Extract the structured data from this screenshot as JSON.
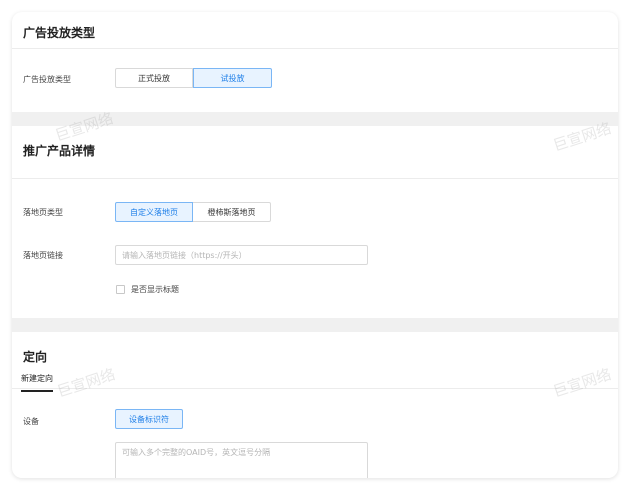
{
  "ad_type_section": {
    "title": "广告投放类型",
    "field_label": "广告投放类型",
    "options": [
      "正式投放",
      "试投放"
    ],
    "selected": "试投放"
  },
  "promo_section": {
    "title": "推广产品详情",
    "landing_type_label": "落地页类型",
    "landing_options": [
      "自定义落地页",
      "橙柿斯落地页"
    ],
    "landing_selected": "自定义落地页",
    "url_label": "落地页链接",
    "url_placeholder": "请输入落地页链接（https://开头）",
    "show_title_label": "是否显示标题",
    "show_title_checked": false
  },
  "targeting_section": {
    "title": "定向",
    "tab_label": "新建定向",
    "device_label": "设备",
    "device_button": "设备标识符",
    "oaid_placeholder": "可输入多个完整的OAID号，英文逗号分隔"
  },
  "watermark": "巨宣网络",
  "colors": {
    "accent": "#1f7fe8",
    "accent_bg": "#e8f3ff",
    "accent_border": "#7ab6f5",
    "page_bg": "#f0f0f0"
  }
}
